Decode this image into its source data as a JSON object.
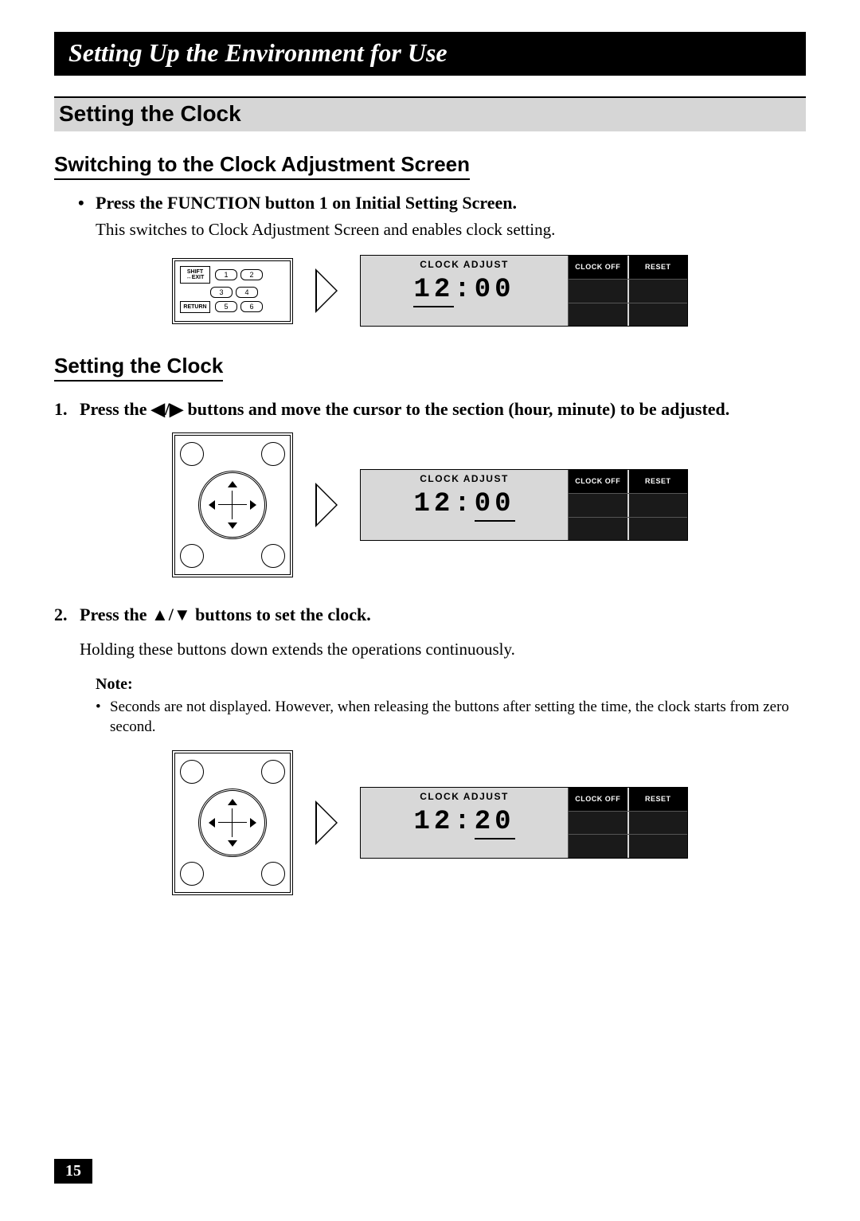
{
  "chapter_title": "Setting Up the Environment for Use",
  "section_title": "Setting the Clock",
  "sub1_title": "Switching to the Clock Adjustment Screen",
  "sub1_bullet": "Press the FUNCTION button 1 on Initial Setting Screen.",
  "sub1_body": "This switches to Clock Adjustment Screen and enables clock setting.",
  "keypad": {
    "shift": "SHIFT\n↔EXIT",
    "return": "RETURN",
    "n1": "1",
    "n2": "2",
    "n3": "3",
    "n4": "4",
    "n5": "5",
    "n6": "6"
  },
  "screen": {
    "label": "CLOCK ADJUST",
    "btn_clock_off": "CLOCK OFF",
    "btn_reset": "RESET"
  },
  "time1": {
    "hh": "12",
    "mm": "00"
  },
  "sub2_title": "Setting the Clock",
  "step1_num": "1.",
  "step1_text": "Press the ◀/▶ buttons and move the cursor to the section (hour, minute) to be adjusted.",
  "time2": {
    "hh": "12",
    "mm": "00"
  },
  "step2_num": "2.",
  "step2_text": "Press the ▲/▼ buttons to set the clock.",
  "step2_body": "Holding these buttons down extends the operations continuously.",
  "note_label": "Note:",
  "note_text": "Seconds are not displayed. However, when releasing the buttons after setting the time, the clock starts from zero second.",
  "time3": {
    "hh": "12",
    "mm": "20"
  },
  "page_number": "15"
}
